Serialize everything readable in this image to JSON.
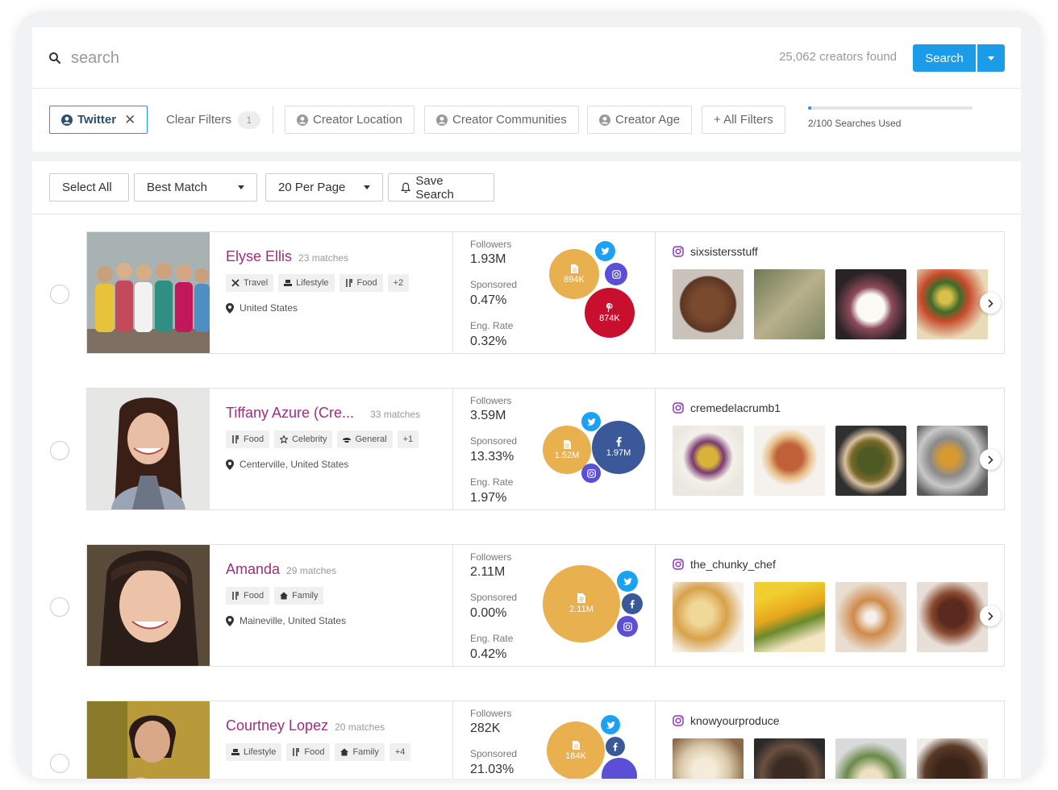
{
  "search": {
    "placeholder": "search",
    "found_text": "25,062 creators found",
    "button_label": "Search"
  },
  "filters": {
    "active_chip": "Twitter",
    "clear_label": "Clear Filters",
    "clear_count": "1",
    "location": "Creator Location",
    "communities": "Creator Communities",
    "age": "Creator Age",
    "all_filters": "+ All Filters",
    "quota_text": "2/100 Searches Used",
    "quota_fraction": 0.02
  },
  "toolbar": {
    "select_all": "Select All",
    "sort": "Best Match",
    "per_page": "20 Per Page",
    "save_search": "Save Search"
  },
  "labels": {
    "followers": "Followers",
    "sponsored": "Sponsored",
    "eng_rate": "Eng. Rate"
  },
  "colors": {
    "accent": "#1b9be8",
    "name": "#9c2f7f",
    "blog": "#e8b04e",
    "pinterest": "#c8102e",
    "facebook": "#3b5998",
    "instagram": "#5b4fd6",
    "twitter": "#1da1f2"
  },
  "creators": [
    {
      "name": "Elyse Ellis",
      "matches": "23 matches",
      "tags": [
        {
          "icon": "plane-icon",
          "label": "Travel"
        },
        {
          "icon": "lifestyle-icon",
          "label": "Lifestyle"
        },
        {
          "icon": "utensils-icon",
          "label": "Food"
        },
        {
          "icon": "",
          "label": "+2"
        }
      ],
      "location": "United States",
      "followers": "1.93M",
      "sponsored": "0.47%",
      "eng_rate": "0.32%",
      "bubbles": [
        {
          "kind": "blog",
          "label": "894K"
        },
        {
          "kind": "pinterest",
          "label": "874K"
        }
      ],
      "instagram_handle": "sixsistersstuff"
    },
    {
      "name": "Tiffany Azure (Cre...",
      "matches": "33 matches",
      "tags": [
        {
          "icon": "utensils-icon",
          "label": "Food"
        },
        {
          "icon": "star-icon",
          "label": "Celebrity"
        },
        {
          "icon": "general-icon",
          "label": "General"
        },
        {
          "icon": "",
          "label": "+1"
        }
      ],
      "location": "Centerville, United States",
      "followers": "3.59M",
      "sponsored": "13.33%",
      "eng_rate": "1.97%",
      "bubbles": [
        {
          "kind": "blog",
          "label": "1.52M"
        },
        {
          "kind": "facebook",
          "label": "1.97M"
        }
      ],
      "instagram_handle": "cremedelacrumb1"
    },
    {
      "name": "Amanda",
      "matches": "29 matches",
      "tags": [
        {
          "icon": "utensils-icon",
          "label": "Food"
        },
        {
          "icon": "home-icon",
          "label": "Family"
        }
      ],
      "location": "Maineville, United States",
      "followers": "2.11M",
      "sponsored": "0.00%",
      "eng_rate": "0.42%",
      "bubbles": [
        {
          "kind": "blog",
          "label": "2.11M"
        }
      ],
      "instagram_handle": "the_chunky_chef"
    },
    {
      "name": "Courtney Lopez",
      "matches": "20 matches",
      "tags": [
        {
          "icon": "lifestyle-icon",
          "label": "Lifestyle"
        },
        {
          "icon": "utensils-icon",
          "label": "Food"
        },
        {
          "icon": "home-icon",
          "label": "Family"
        },
        {
          "icon": "",
          "label": "+4"
        }
      ],
      "location": "",
      "followers": "282K",
      "sponsored": "21.03%",
      "eng_rate": "",
      "bubbles": [
        {
          "kind": "blog",
          "label": "184K"
        }
      ],
      "instagram_handle": "knowyourproduce"
    }
  ]
}
